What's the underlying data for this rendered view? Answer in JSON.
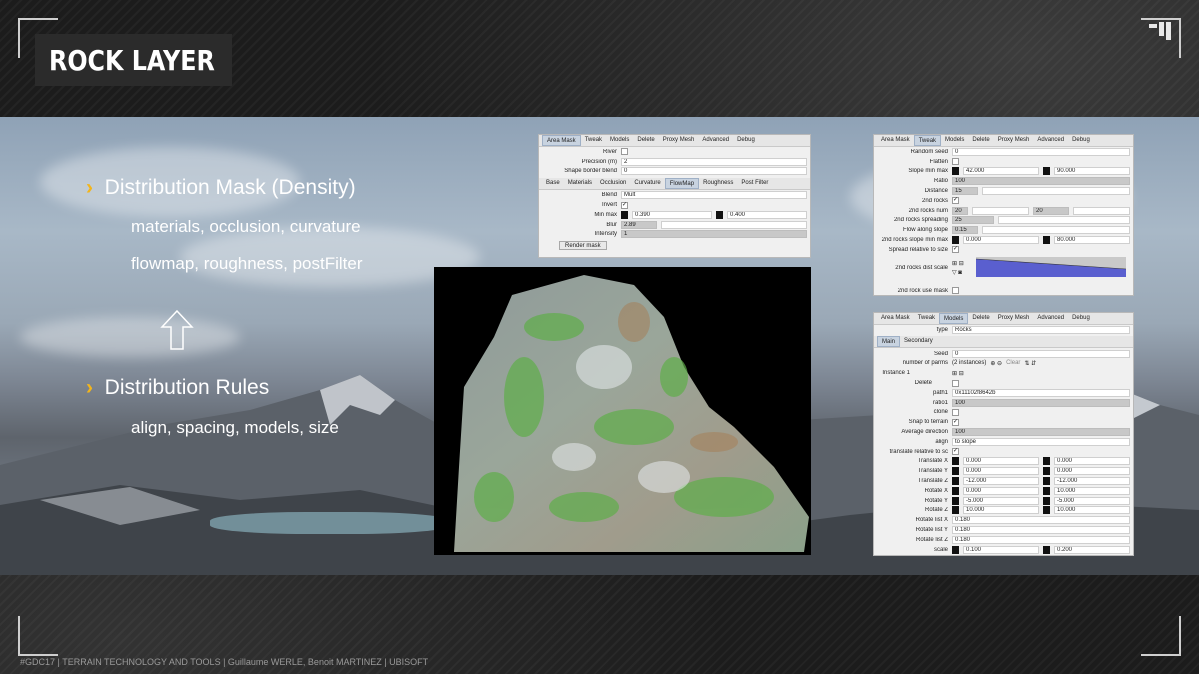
{
  "slide": {
    "title": "ROCK LAYER",
    "footer": "#GDC17 | TERRAIN TECHNOLOGY AND TOOLS | Guillaume WERLE, Benoit MARTINEZ | UBISOFT",
    "bullets": [
      {
        "marker": "›",
        "heading": "Distribution Mask (Density)",
        "lines": [
          "materials, occlusion, curvature",
          "flowmap, roughness, postFilter"
        ]
      },
      {
        "marker": "›",
        "heading": "Distribution Rules",
        "lines": [
          "align, spacing, models, size"
        ]
      }
    ],
    "colors": {
      "accent": "#f3b51b",
      "title_bg": "#2b2b2b"
    }
  },
  "panel_mask": {
    "tabs": [
      "Area Mask",
      "Tweak",
      "Models",
      "Delete",
      "Proxy Mesh",
      "Advanced",
      "Debug"
    ],
    "active_tab": "Area Mask",
    "rows": [
      {
        "label": "River",
        "value": ""
      },
      {
        "label": "Precision (m)",
        "value": "2"
      },
      {
        "label": "Shape border blend",
        "value": "0"
      }
    ],
    "subtabs": [
      "Base",
      "Materials",
      "Occlusion",
      "Curvature",
      "FlowMap",
      "Roughness",
      "Post Filter"
    ],
    "active_subtab": "FlowMap",
    "fm_rows": [
      {
        "label": "Blend",
        "value": "Mult"
      },
      {
        "label": "Invert",
        "value": "✓"
      },
      {
        "label": "Min max",
        "v1": "0.390",
        "v2": "0.400"
      },
      {
        "label": "Blur",
        "value": "2.89"
      },
      {
        "label": "Intensity",
        "value": "1"
      }
    ],
    "render_button": "Render mask"
  },
  "panel_tweak": {
    "tabs": [
      "Area Mask",
      "Tweak",
      "Models",
      "Delete",
      "Proxy Mesh",
      "Advanced",
      "Debug"
    ],
    "active_tab": "Tweak",
    "rows": [
      {
        "label": "Random seed",
        "value": "0"
      },
      {
        "label": "Flatten",
        "value": ""
      },
      {
        "label": "Slope min max",
        "v1": "42.000",
        "v2": "90.000"
      },
      {
        "label": "Ratio",
        "value": "100"
      },
      {
        "label": "Distance",
        "value": "15"
      },
      {
        "label": "2nd rocks",
        "value": "✓"
      },
      {
        "label": "2nd rocks num",
        "v1": "20",
        "v2": "20"
      },
      {
        "label": "2nd rocks spreading",
        "value": "25"
      },
      {
        "label": "Flow along slope",
        "value": "0.15"
      },
      {
        "label": "2nd rocks slope min max",
        "v1": "0.000",
        "v2": "80.000"
      },
      {
        "label": "Spread relative to size",
        "value": "✓"
      },
      {
        "label": "2nd rocks dist scale",
        "value": ""
      },
      {
        "label": "2nd rock use mask",
        "value": ""
      }
    ],
    "curve_axis": [
      "0",
      "1"
    ]
  },
  "panel_models": {
    "tabs": [
      "Area Mask",
      "Tweak",
      "Models",
      "Delete",
      "Proxy Mesh",
      "Advanced",
      "Debug"
    ],
    "active_tab": "Models",
    "type_label": "type",
    "type_value": "Rocks",
    "subtabs": [
      "Main",
      "Secondary"
    ],
    "rows": [
      {
        "label": "Seed",
        "value": "0"
      },
      {
        "label": "number of parms",
        "value": "(2 instances)"
      },
      {
        "label": "Instance 1",
        "value": ""
      },
      {
        "label": "Delete",
        "value": ""
      },
      {
        "label": "path1",
        "value": "0x11102f8642b"
      },
      {
        "label": "ratio1",
        "value": "100"
      },
      {
        "label": "clone",
        "value": ""
      },
      {
        "label": "Snap to terrain",
        "value": "✓"
      },
      {
        "label": "Average direction",
        "value": "100"
      },
      {
        "label": "align",
        "value": "to slope"
      },
      {
        "label": "translate relative to sc",
        "value": "✓"
      },
      {
        "label": "Translate X",
        "v1": "0.000",
        "v2": "0.000"
      },
      {
        "label": "Translate Y",
        "v1": "0.000",
        "v2": "0.000"
      },
      {
        "label": "Translate Z",
        "v1": "-12.000",
        "v2": "-12.000"
      },
      {
        "label": "Rotate X",
        "v1": "0.000",
        "v2": "10.000"
      },
      {
        "label": "Rotate Y",
        "v1": "-5.000",
        "v2": "-5.000"
      },
      {
        "label": "Rotate Z",
        "v1": "10.000",
        "v2": "10.000"
      },
      {
        "label": "Rotate list X",
        "value": "0.180"
      },
      {
        "label": "Rotate list Y",
        "value": "0.180"
      },
      {
        "label": "Rotate list Z",
        "value": "0.180"
      },
      {
        "label": "scale",
        "v1": "0.100",
        "v2": "0.200"
      }
    ],
    "clear_label": "Clear"
  }
}
